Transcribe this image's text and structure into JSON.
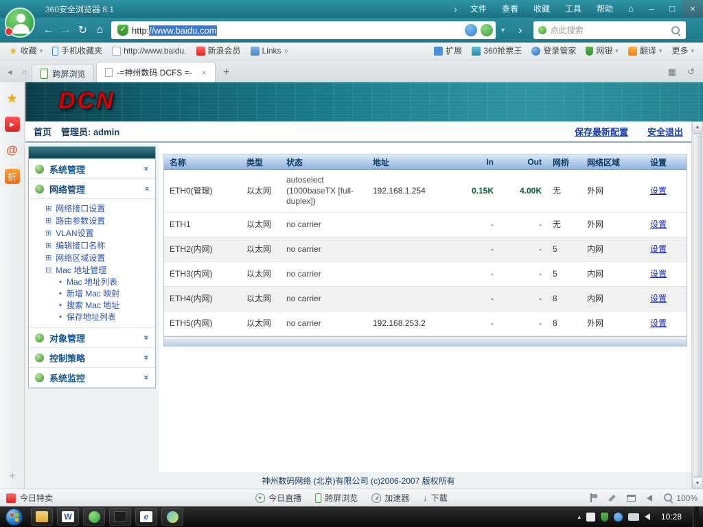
{
  "icons": {
    "collapse_arrow": "›",
    "home": "⌂",
    "minimize": "–",
    "maximize": "□",
    "close": "×",
    "back": "←",
    "forward": "→",
    "refresh": "↻",
    "caret_down": "▾",
    "go_arrow": "›",
    "shield_check": "✓",
    "favorites_star": "★",
    "links_more": "»",
    "tab_prev": "◂",
    "tab_restore": "○",
    "tab_close": "×",
    "new_tab": "+",
    "screenshot": "▦",
    "undo": "↺",
    "double_chevron": "»",
    "win_box": "⊞",
    "win_box_open": "⊟",
    "bullet": "•",
    "play": "▶",
    "download": "↓",
    "sidebar_star": "★",
    "sidebar_play": "▶",
    "sidebar_at": "@",
    "sidebar_plus": "+",
    "scroll_up": "▲",
    "scroll_down": "▼",
    "word": "W",
    "ie": "e",
    "tray_expand": "▴"
  },
  "titlebar": {
    "title": "360安全浏览器 8.1",
    "menus": [
      "文件",
      "查看",
      "收藏",
      "工具",
      "帮助"
    ]
  },
  "toolbar": {
    "address_scheme": "http:",
    "address_selected": "//www.baidu.com",
    "search_placeholder": "点此搜索"
  },
  "bookmarks": {
    "favorites_label": "收藏",
    "items": [
      {
        "label": "手机收藏夹"
      },
      {
        "label": "http://www.baidu."
      },
      {
        "label": "新浪会员"
      },
      {
        "label": "Links"
      }
    ],
    "right_items": [
      {
        "label": "扩展"
      },
      {
        "label": "360抢票王"
      },
      {
        "label": "登录管家"
      },
      {
        "label": "网银"
      },
      {
        "label": "翻译"
      },
      {
        "label": "更多"
      }
    ]
  },
  "tabs": {
    "cross_screen": "跨屏浏览",
    "dcfs": "-=神州数码 DCFS =-"
  },
  "sidebar": {
    "discount_label": "折"
  },
  "page": {
    "logo": "DCN",
    "header": {
      "home": "首页",
      "admin_label": "管理员: admin",
      "save_config": "保存最新配置",
      "logout": "安全退出"
    },
    "nav": {
      "sections": [
        {
          "label": "系统管理"
        },
        {
          "label": "网络管理"
        },
        {
          "label": "对象管理"
        },
        {
          "label": "控制策略"
        },
        {
          "label": "系统监控"
        }
      ],
      "network_items": [
        "网络接口设置",
        "路由参数设置",
        "VLAN设置",
        "编辑接口名称",
        "网络区域设置",
        "Mac 地址管理"
      ],
      "mac_items": [
        "Mac 地址列表",
        "新增 Mac 映射",
        "搜索 Mac 地址",
        "保存地址列表"
      ]
    },
    "table": {
      "headers": [
        "名称",
        "类型",
        "状态",
        "地址",
        "In",
        "Out",
        "网桥",
        "网络区域",
        "设置"
      ],
      "rows": [
        {
          "name": "ETH0(管理)",
          "type": "以太网",
          "status": "autoselect (1000baseTX [full-duplex])",
          "address": "192.168.1.254",
          "in": "0.15K",
          "out": "4.00K",
          "bridge": "无",
          "zone": "外网",
          "action": "设置"
        },
        {
          "name": "ETH1",
          "type": "以太网",
          "status": "no carrier",
          "address": "",
          "in": "-",
          "out": "-",
          "bridge": "无",
          "zone": "外网",
          "action": "设置"
        },
        {
          "name": "ETH2(内网)",
          "type": "以太网",
          "status": "no carrier",
          "address": "",
          "in": "-",
          "out": "-",
          "bridge": "5",
          "zone": "内网",
          "action": "设置"
        },
        {
          "name": "ETH3(内网)",
          "type": "以太网",
          "status": "no carrier",
          "address": "",
          "in": "-",
          "out": "-",
          "bridge": "5",
          "zone": "内网",
          "action": "设置"
        },
        {
          "name": "ETH4(内网)",
          "type": "以太网",
          "status": "no carrier",
          "address": "",
          "in": "-",
          "out": "-",
          "bridge": "8",
          "zone": "内网",
          "action": "设置"
        },
        {
          "name": "ETH5(内网)",
          "type": "以太网",
          "status": "no carrier",
          "address": "192.168.253.2",
          "in": "-",
          "out": "-",
          "bridge": "8",
          "zone": "外网",
          "action": "设置"
        }
      ]
    },
    "footer": "神州数码网络 (北京)有限公司 (c)2006-2007 版权所有"
  },
  "statusbar": {
    "deal": "今日特卖",
    "live": "今日直播",
    "cross_screen": "跨屏浏览",
    "accelerator": "加速器",
    "download": "下载",
    "zoom": "100%"
  },
  "taskbar": {
    "time": "10:28"
  }
}
